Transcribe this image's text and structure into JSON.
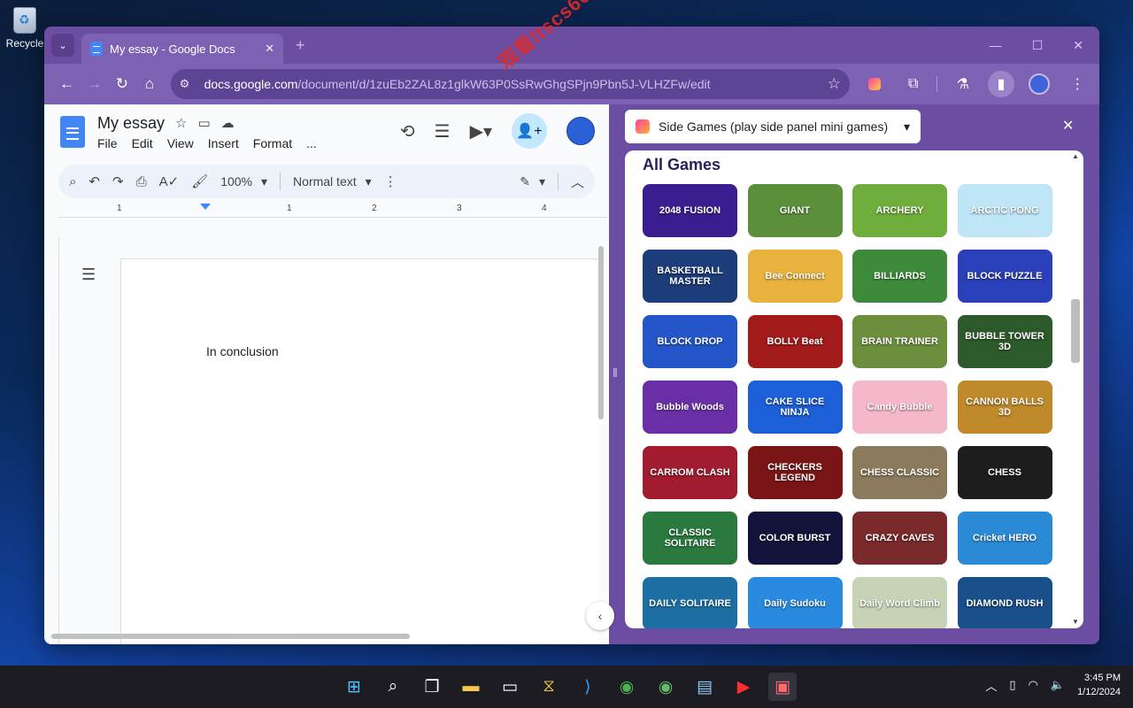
{
  "desktop": {
    "recycle_label": "Recycle"
  },
  "browser": {
    "tab_title": "My essay - Google Docs",
    "url_host": "docs.google.com",
    "url_path": "/document/d/1zuEb2ZAL8z1glkW63P0SsRwGhgSPjn9Pbn5J-VLHZFw/edit"
  },
  "docs": {
    "title": "My essay",
    "menu": [
      "File",
      "Edit",
      "View",
      "Insert",
      "Format",
      "..."
    ],
    "zoom": "100%",
    "style": "Normal text",
    "ruler_marks": [
      "1",
      "1",
      "2",
      "3",
      "4"
    ],
    "body_text": "In conclusion"
  },
  "side_panel": {
    "selector_label": "Side Games (play side panel mini games)",
    "heading": "All Games",
    "games": [
      {
        "name": "2048 FUSION",
        "bg": "#3a1d8f"
      },
      {
        "name": "GIANT",
        "bg": "#5c8f3a"
      },
      {
        "name": "ARCHERY",
        "bg": "#6fae3c"
      },
      {
        "name": "ARCTIC PONG",
        "bg": "#bfe6f7"
      },
      {
        "name": "BASKETBALL MASTER",
        "bg": "#1d3c7a"
      },
      {
        "name": "Bee Connect",
        "bg": "#e8b23d"
      },
      {
        "name": "BILLIARDS",
        "bg": "#3c8a3a"
      },
      {
        "name": "BLOCK PUZZLE",
        "bg": "#2a3fb8"
      },
      {
        "name": "BLOCK DROP",
        "bg": "#2456c9"
      },
      {
        "name": "BOLLY Beat",
        "bg": "#a31a1a"
      },
      {
        "name": "BRAIN TRAINER",
        "bg": "#6b8f3c"
      },
      {
        "name": "BUBBLE TOWER 3D",
        "bg": "#2d5a2a"
      },
      {
        "name": "Bubble Woods",
        "bg": "#6a2fa6"
      },
      {
        "name": "CAKE SLICE NINJA",
        "bg": "#1c5fd6"
      },
      {
        "name": "Candy Bubble",
        "bg": "#f4b8c8"
      },
      {
        "name": "CANNON BALLS 3D",
        "bg": "#c08a2a"
      },
      {
        "name": "CARROM CLASH",
        "bg": "#a11c2e"
      },
      {
        "name": "CHECKERS LEGEND",
        "bg": "#7a1515"
      },
      {
        "name": "CHESS CLASSIC",
        "bg": "#8b7a5c"
      },
      {
        "name": "CHESS",
        "bg": "#1d1d1d"
      },
      {
        "name": "CLASSIC SOLITAIRE",
        "bg": "#2a7a3f"
      },
      {
        "name": "COLOR BURST",
        "bg": "#12123a"
      },
      {
        "name": "CRAZY CAVES",
        "bg": "#7a2a2a"
      },
      {
        "name": "Cricket HERO",
        "bg": "#2a8ad6"
      },
      {
        "name": "DAILY SOLITAIRE",
        "bg": "#1d6fa3"
      },
      {
        "name": "Daily Sudoku",
        "bg": "#2a8ae0"
      },
      {
        "name": "Daily Word Climb",
        "bg": "#c7d3b5"
      },
      {
        "name": "DIAMOND RUSH",
        "bg": "#1a4f8a"
      }
    ]
  },
  "watermark": "观看ltscs66",
  "taskbar": {
    "time": "3:45 PM",
    "date": "1/12/2024"
  }
}
